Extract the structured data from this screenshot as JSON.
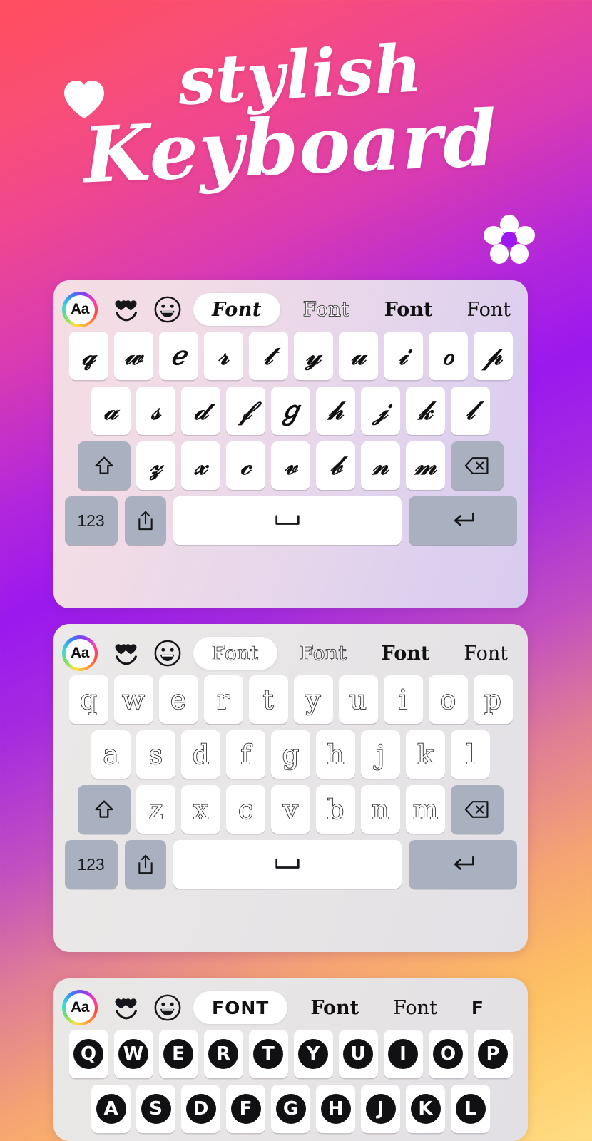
{
  "hero": {
    "heart_icon": "heart-icon",
    "flower_icon": "flower-icon",
    "title_line1": "stylish",
    "title_line2": "Keyboard"
  },
  "colors": {
    "gradient_top_left": "#ff4d5e",
    "gradient_mid_purple": "#9b18ef",
    "gradient_bottom": "#ffdd85",
    "key_face": "#ffffff",
    "key_special": "#a9b0bf",
    "glyph": "#111114"
  },
  "keyboards": [
    {
      "id": "keyboard-1",
      "panel_tint": "#efdbe8",
      "toolbar": {
        "aa_label": "Aa",
        "emoji_1": "heart-eyes-emoji",
        "emoji_2": "grinning-face-emoji",
        "chips": [
          {
            "label": "Font",
            "style": "script",
            "selected": true
          },
          {
            "label": "Font",
            "style": "outline",
            "selected": false
          },
          {
            "label": "Font",
            "style": "boldserif",
            "selected": false
          },
          {
            "label": "Font",
            "style": "serif",
            "selected": false
          }
        ]
      },
      "glyph_style": "script",
      "rows": [
        [
          "𝓆",
          "𝓌",
          "ℯ",
          "𝓇",
          "𝓉",
          "𝓎",
          "𝓊",
          "𝒾",
          "ℴ",
          "𝓅"
        ],
        [
          "𝒶",
          "𝓈",
          "𝒹",
          "𝒻",
          "ℊ",
          "𝒽",
          "𝒿",
          "𝓀",
          "𝓁"
        ],
        [
          "𝓏",
          "𝓍",
          "𝒸",
          "𝓋",
          "𝒷",
          "𝓃",
          "𝓂"
        ]
      ],
      "bottom": {
        "shift": "shift-icon",
        "backspace": "backspace-icon",
        "numbers": "123",
        "share": "share-icon",
        "space": "space-icon",
        "enter": "return-icon"
      }
    },
    {
      "id": "keyboard-2",
      "panel_tint": "#e6e4e5",
      "toolbar": {
        "aa_label": "Aa",
        "emoji_1": "heart-eyes-emoji",
        "emoji_2": "grinning-face-emoji",
        "chips": [
          {
            "label": "Font",
            "style": "outline",
            "selected": true
          },
          {
            "label": "Font",
            "style": "outline",
            "selected": false
          },
          {
            "label": "Font",
            "style": "boldserif",
            "selected": false
          },
          {
            "label": "Font",
            "style": "serif",
            "selected": false
          }
        ]
      },
      "glyph_style": "outline",
      "rows": [
        [
          "q",
          "w",
          "e",
          "r",
          "t",
          "y",
          "u",
          "i",
          "o",
          "p"
        ],
        [
          "a",
          "s",
          "d",
          "f",
          "g",
          "h",
          "j",
          "k",
          "l"
        ],
        [
          "z",
          "x",
          "c",
          "v",
          "b",
          "n",
          "m"
        ]
      ],
      "bottom": {
        "shift": "shift-icon",
        "backspace": "backspace-icon",
        "numbers": "123",
        "share": "share-icon",
        "space": "space-icon",
        "enter": "return-icon"
      }
    },
    {
      "id": "keyboard-3",
      "panel_tint": "#e5e3e4",
      "toolbar": {
        "aa_label": "Aa",
        "emoji_1": "heart-eyes-emoji",
        "emoji_2": "grinning-face-emoji",
        "chips": [
          {
            "label": "FONT",
            "style": "circle",
            "selected": true
          },
          {
            "label": "Font",
            "style": "boldserif",
            "selected": false
          },
          {
            "label": "Font",
            "style": "serif",
            "selected": false
          },
          {
            "label": "F",
            "style": "circle",
            "selected": false
          }
        ]
      },
      "glyph_style": "circled",
      "rows": [
        [
          "Q",
          "W",
          "E",
          "R",
          "T",
          "Y",
          "U",
          "I",
          "O",
          "P"
        ],
        [
          "A",
          "S",
          "D",
          "F",
          "G",
          "H",
          "J",
          "K",
          "L"
        ]
      ],
      "bottom": null
    }
  ]
}
